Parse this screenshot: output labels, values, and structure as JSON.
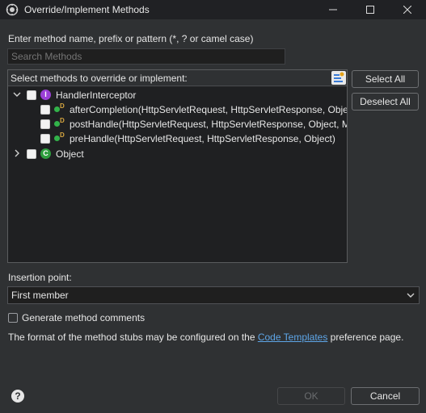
{
  "window": {
    "title": "Override/Implement Methods"
  },
  "filter": {
    "label": "Enter method name, prefix or pattern (*, ? or camel case)",
    "placeholder": "Search Methods"
  },
  "methods_panel": {
    "header": "Select methods to override or implement:",
    "sort_icon": "sort-icon",
    "tree": [
      {
        "label": "HandlerInterceptor",
        "kind": "interface",
        "badge": "I",
        "expanded": true,
        "checked": false,
        "children": [
          {
            "label": "afterCompletion(HttpServletRequest, HttpServletResponse, Obje",
            "modifier": "D",
            "checked": false
          },
          {
            "label": "postHandle(HttpServletRequest, HttpServletResponse, Object, M",
            "modifier": "D",
            "checked": false
          },
          {
            "label": "preHandle(HttpServletRequest, HttpServletResponse, Object)",
            "modifier": "D",
            "checked": false
          }
        ]
      },
      {
        "label": "Object",
        "kind": "class",
        "badge": "C",
        "expanded": false,
        "checked": false
      }
    ]
  },
  "buttons": {
    "select_all": "Select All",
    "deselect_all": "Deselect All",
    "ok": "OK",
    "cancel": "Cancel"
  },
  "insertion": {
    "label": "Insertion point:",
    "value": "First member"
  },
  "generate_comments": {
    "label": "Generate method comments",
    "checked": false
  },
  "info": {
    "text_before": "The format of the method stubs may be configured on the ",
    "link": "Code Templates",
    "text_after": " preference page."
  },
  "colors": {
    "interface_badge": "#9b3fd6",
    "class_badge": "#2e9e3e",
    "method_dot": "#32b34a",
    "link": "#5ea6e8"
  }
}
